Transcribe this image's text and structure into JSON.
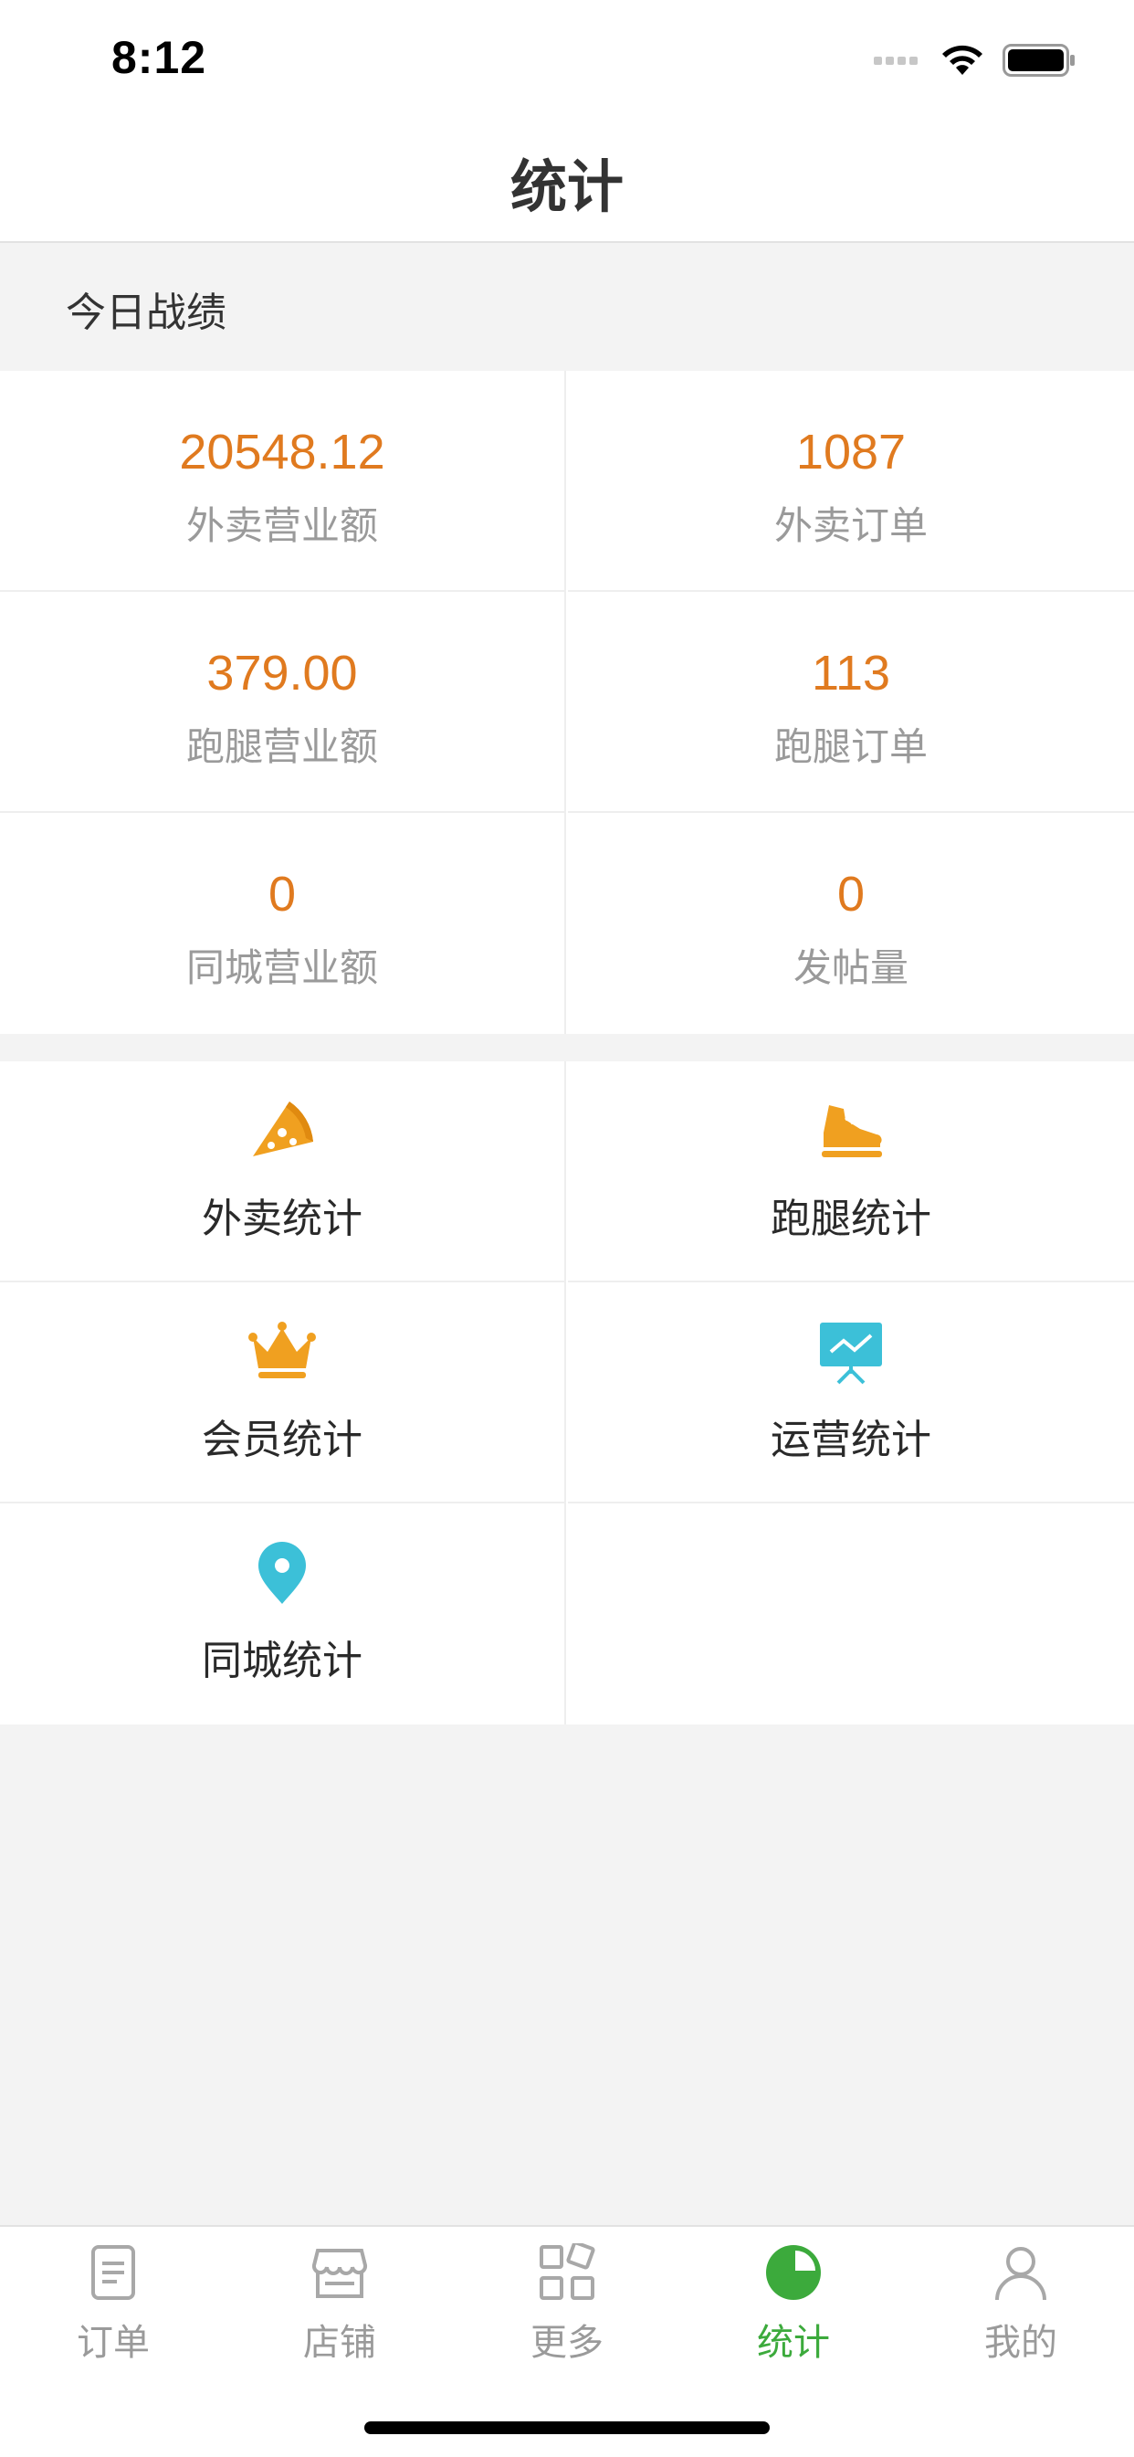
{
  "status_bar": {
    "time": "8:12"
  },
  "nav": {
    "title": "统计"
  },
  "section": {
    "title": "今日战绩"
  },
  "stats": [
    {
      "value": "20548.12",
      "label": "外卖营业额"
    },
    {
      "value": "1087",
      "label": "外卖订单"
    },
    {
      "value": "379.00",
      "label": "跑腿营业额"
    },
    {
      "value": "113",
      "label": "跑腿订单"
    },
    {
      "value": "0",
      "label": "同城营业额"
    },
    {
      "value": "0",
      "label": "发帖量"
    }
  ],
  "menu": [
    {
      "label": "外卖统计",
      "icon": "pizza-icon"
    },
    {
      "label": "跑腿统计",
      "icon": "shoe-icon"
    },
    {
      "label": "会员统计",
      "icon": "crown-icon"
    },
    {
      "label": "运营统计",
      "icon": "presentation-chart-icon"
    },
    {
      "label": "同城统计",
      "icon": "location-pin-icon"
    }
  ],
  "tabs": [
    {
      "label": "订单",
      "icon": "document-icon"
    },
    {
      "label": "店铺",
      "icon": "store-icon"
    },
    {
      "label": "更多",
      "icon": "grid-icon"
    },
    {
      "label": "统计",
      "icon": "pie-chart-icon",
      "active": true
    },
    {
      "label": "我的",
      "icon": "user-icon"
    }
  ],
  "colors": {
    "accent_orange": "#e07a1f",
    "active_green": "#3caa3c",
    "icon_orange": "#f0a020",
    "icon_teal": "#3cc0d8"
  }
}
